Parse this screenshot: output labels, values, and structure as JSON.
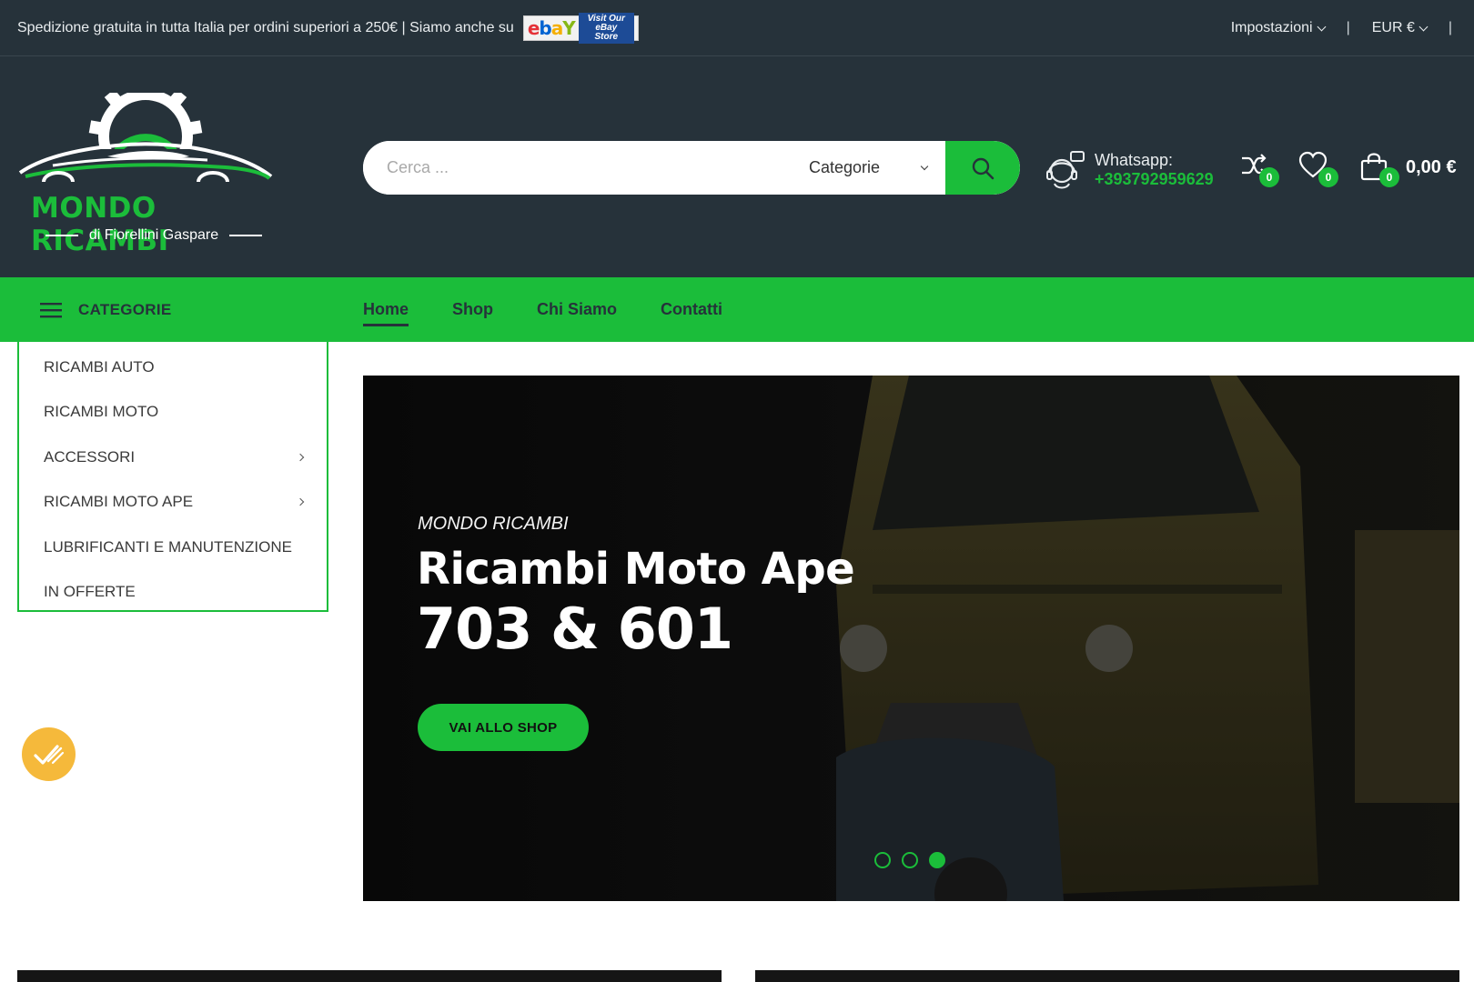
{
  "topbar": {
    "notice": "Spedizione gratuita in tutta Italia per ordini superiori a 250€ | Siamo anche su",
    "ebay_logo": "ebY",
    "ebay_store_line1": "Visit Our",
    "ebay_store_line2": "eBay Store",
    "settings_label": "Impostazioni",
    "currency_label": "EUR €",
    "separator": "|"
  },
  "brand": {
    "name": "MONDO RICAMBI",
    "subtitle": "di Fiorellini Gaspare"
  },
  "search": {
    "placeholder": "Cerca ...",
    "category_label": "Categorie"
  },
  "whatsapp": {
    "label": "Whatsapp:",
    "number": "+393792959629"
  },
  "header_counts": {
    "compare": "0",
    "wishlist": "0",
    "cart": "0",
    "cart_total": "0,00 €"
  },
  "nav": {
    "categories_label": "CATEGORIE",
    "items": [
      "Home",
      "Shop",
      "Chi Siamo",
      "Contatti"
    ]
  },
  "categories": [
    {
      "label": "RICAMBI AUTO",
      "has_sub": false
    },
    {
      "label": "RICAMBI MOTO",
      "has_sub": false
    },
    {
      "label": "ACCESSORI",
      "has_sub": true
    },
    {
      "label": "RICAMBI MOTO APE",
      "has_sub": true
    },
    {
      "label": "LUBRIFICANTI E MANUTENZIONE",
      "has_sub": false
    },
    {
      "label": "IN OFFERTE",
      "has_sub": false
    }
  ],
  "hero": {
    "eyebrow": "MONDO RICAMBI",
    "title_line1": "Ricambi Moto Ape",
    "title_line2": "703 & 601",
    "cta_label": "VAI ALLO SHOP",
    "slides_total": 3,
    "active_slide": 3
  },
  "colors": {
    "accent": "#1bbd3a",
    "dark": "#26323a",
    "badge": "#f5b93b"
  }
}
